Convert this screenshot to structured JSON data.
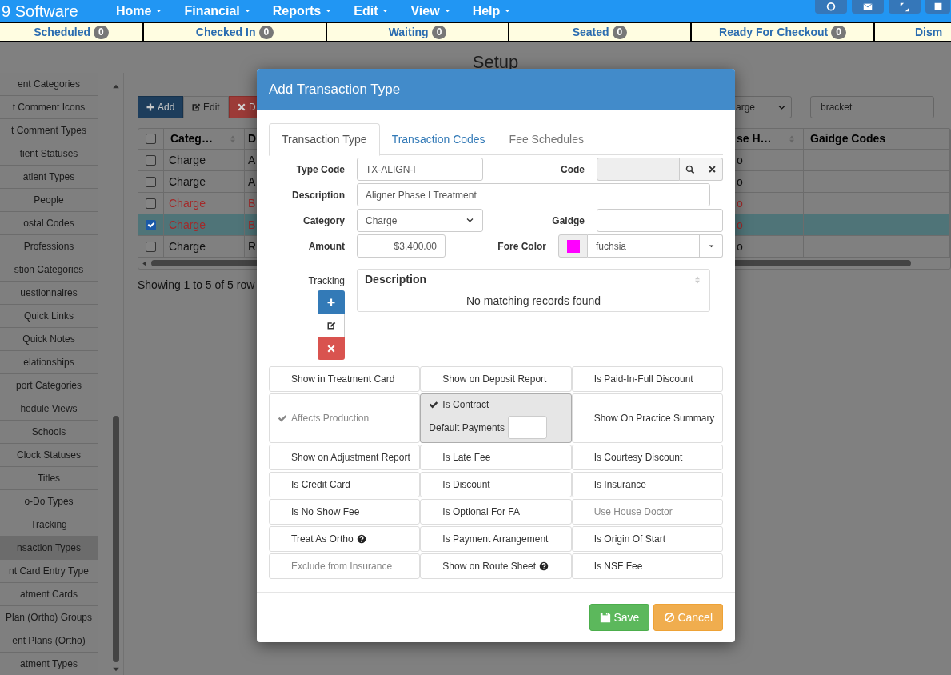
{
  "top_nav": {
    "logo": "9 Software",
    "menus": [
      "Home",
      "Financial",
      "Reports",
      "Edit",
      "View",
      "Help"
    ]
  },
  "status_tabs": [
    {
      "label": "Scheduled",
      "count": "0"
    },
    {
      "label": "Checked In",
      "count": "0"
    },
    {
      "label": "Waiting",
      "count": "0"
    },
    {
      "label": "Seated",
      "count": "0"
    },
    {
      "label": "Ready For Checkout",
      "count": "0"
    },
    {
      "label": "Dism"
    }
  ],
  "page_title": "Setup",
  "sidebar": {
    "items": [
      {
        "label": "ent Categories",
        "selected": false
      },
      {
        "label": "t Comment Icons",
        "selected": false
      },
      {
        "label": "t Comment Types",
        "selected": false
      },
      {
        "label": "tient Statuses",
        "selected": false
      },
      {
        "label": "atient Types",
        "selected": false
      },
      {
        "label": "People",
        "selected": false
      },
      {
        "label": "ostal Codes",
        "selected": false
      },
      {
        "label": "Professions",
        "selected": false
      },
      {
        "label": "stion Categories",
        "selected": false
      },
      {
        "label": "uestionnaires",
        "selected": false
      },
      {
        "label": "Quick Links",
        "selected": false
      },
      {
        "label": "Quick Notes",
        "selected": false
      },
      {
        "label": "elationships",
        "selected": false
      },
      {
        "label": "port Categories",
        "selected": false
      },
      {
        "label": "hedule Views",
        "selected": false
      },
      {
        "label": "Schools",
        "selected": false
      },
      {
        "label": "Clock Statuses",
        "selected": false
      },
      {
        "label": "Titles",
        "selected": false
      },
      {
        "label": "o-Do Types",
        "selected": false
      },
      {
        "label": "Tracking",
        "selected": false
      },
      {
        "label": "nsaction Types",
        "selected": true
      },
      {
        "label": "nt Card Entry Type",
        "selected": false
      },
      {
        "label": "atment Cards",
        "selected": false
      },
      {
        "label": "Plan (Ortho) Groups",
        "selected": false
      },
      {
        "label": "ent Plans (Ortho)",
        "selected": false
      },
      {
        "label": "atment Types",
        "selected": false
      }
    ]
  },
  "toolbar": {
    "buttons": [
      {
        "kind": "add",
        "label": "Add"
      },
      {
        "kind": "edit",
        "label": "Edit"
      },
      {
        "kind": "delete",
        "label": "D"
      }
    ],
    "filter": {
      "value": "arge"
    },
    "search": {
      "value": "bracket"
    }
  },
  "table": {
    "select_all_checked": false,
    "columns": [
      "Categ…",
      "D",
      "se H…",
      "Gaidge Codes"
    ],
    "rows": [
      {
        "selected": false,
        "color": "#111111",
        "cells": [
          "Charge",
          "A",
          "o"
        ]
      },
      {
        "selected": false,
        "color": "#111111",
        "cells": [
          "Charge",
          "A",
          "o"
        ]
      },
      {
        "selected": false,
        "color": "#a32a2a",
        "cells": [
          "Charge",
          "B",
          "o"
        ]
      },
      {
        "selected": true,
        "color": "#a32a2a",
        "cells": [
          "Charge",
          "B",
          "o"
        ]
      },
      {
        "selected": false,
        "color": "#111111",
        "cells": [
          "Charge",
          "R",
          "o"
        ]
      }
    ],
    "footer": "Showing 1 to 5 of 5 row"
  },
  "modal": {
    "title": "Add Transaction Type",
    "tabs": [
      {
        "label": "Transaction Type",
        "selected": true,
        "disabled": false
      },
      {
        "label": "Transaction Codes",
        "selected": false,
        "disabled": false
      },
      {
        "label": "Fee Schedules",
        "selected": false,
        "disabled": true
      }
    ],
    "fields": {
      "type_code": {
        "label": "Type Code",
        "value": "TX-ALIGN-I"
      },
      "code": {
        "label": "Code",
        "disabled": true
      },
      "description": {
        "label": "Description",
        "value": "Aligner Phase I Treatment"
      },
      "category": {
        "label": "Category",
        "value": "Charge"
      },
      "gaidge": {
        "label": "Gaidge"
      },
      "amount": {
        "label": "Amount",
        "value": "$3,400.00"
      },
      "fore_color": {
        "label": "Fore Color",
        "value": "fuchsia",
        "color": "#ff00ff"
      }
    },
    "tracking": {
      "label": "Tracking",
      "column": "Description",
      "empty_message": "No matching records found"
    },
    "options": [
      {
        "label": "Show in Treatment Card",
        "checked": false,
        "disabled": false,
        "help": false
      },
      {
        "label": "Show on Deposit Report",
        "checked": false,
        "disabled": false,
        "help": false
      },
      {
        "label": "Is Paid-In-Full Discount",
        "checked": false,
        "disabled": false,
        "help": false
      },
      {
        "label": "Affects Production",
        "checked": true,
        "disabled": true,
        "help": false
      },
      {
        "label": "Is Contract",
        "checked": true,
        "disabled": false,
        "help": false,
        "field": {
          "label": "Default Payments"
        }
      },
      {
        "label": "Show On Practice Summary",
        "checked": false,
        "disabled": false,
        "help": false
      },
      {
        "label": "Show on Adjustment Report",
        "checked": false,
        "disabled": false,
        "help": false
      },
      {
        "label": "Is Late Fee",
        "checked": false,
        "disabled": false,
        "help": false
      },
      {
        "label": "Is Courtesy Discount",
        "checked": false,
        "disabled": false,
        "help": false
      },
      {
        "label": "Is Credit Card",
        "checked": false,
        "disabled": false,
        "help": false
      },
      {
        "label": "Is Discount",
        "checked": false,
        "disabled": false,
        "help": false
      },
      {
        "label": "Is Insurance",
        "checked": false,
        "disabled": false,
        "help": false
      },
      {
        "label": "Is No Show Fee",
        "checked": false,
        "disabled": false,
        "help": false
      },
      {
        "label": "Is Optional For FA",
        "checked": false,
        "disabled": false,
        "help": false
      },
      {
        "label": "Use House Doctor",
        "checked": false,
        "disabled": true,
        "help": false
      },
      {
        "label": "Treat As Ortho",
        "checked": false,
        "disabled": false,
        "help": true
      },
      {
        "label": "Is Payment Arrangement",
        "checked": false,
        "disabled": false,
        "help": false
      },
      {
        "label": "Is Origin Of Start",
        "checked": false,
        "disabled": false,
        "help": false
      },
      {
        "label": "Exclude from Insurance",
        "checked": false,
        "disabled": true,
        "help": false
      },
      {
        "label": "Show on Route Sheet",
        "checked": false,
        "disabled": false,
        "help": true
      },
      {
        "label": "Is NSF Fee",
        "checked": false,
        "disabled": false,
        "help": false
      }
    ],
    "buttons": [
      {
        "kind": "save",
        "label": "Save"
      },
      {
        "kind": "cancel",
        "label": "Cancel"
      }
    ]
  }
}
